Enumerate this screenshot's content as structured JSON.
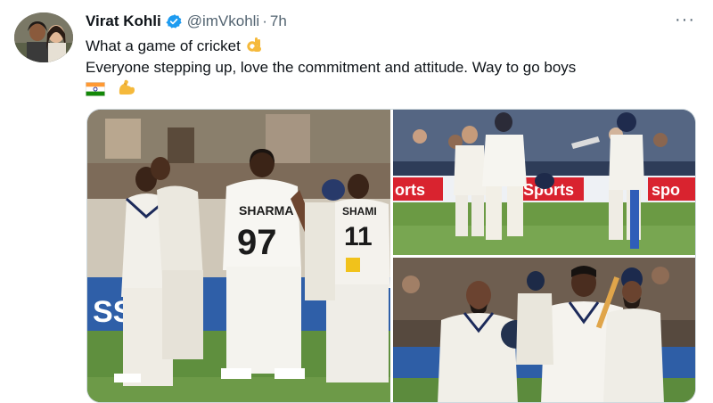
{
  "tweet": {
    "display_name": "Virat Kohli",
    "handle": "@imVkohli",
    "separator": "·",
    "time": "7h",
    "more_label": "···",
    "line1": "What a game of cricket",
    "line2": "Everyone stepping up, love the commitment and attitude. Way to go boys",
    "emojis": [
      "ok-hand",
      "india-flag",
      "flexed-biceps"
    ]
  },
  "photos": {
    "p1": {
      "jersey_name": "SHARMA",
      "jersey_number": "97",
      "jersey_name_2": "SHAMI",
      "jersey_number_2": "11",
      "board_text": "SS U"
    },
    "p2": {
      "board_left": "orts",
      "board_mid": "Sports",
      "board_right": "spo"
    },
    "p3": {}
  },
  "colors": {
    "accent": "#1d9bf0",
    "text": "#0f1419",
    "secondary": "#536471",
    "grass": "#5f8f3e",
    "ad_red": "#d9232f"
  }
}
